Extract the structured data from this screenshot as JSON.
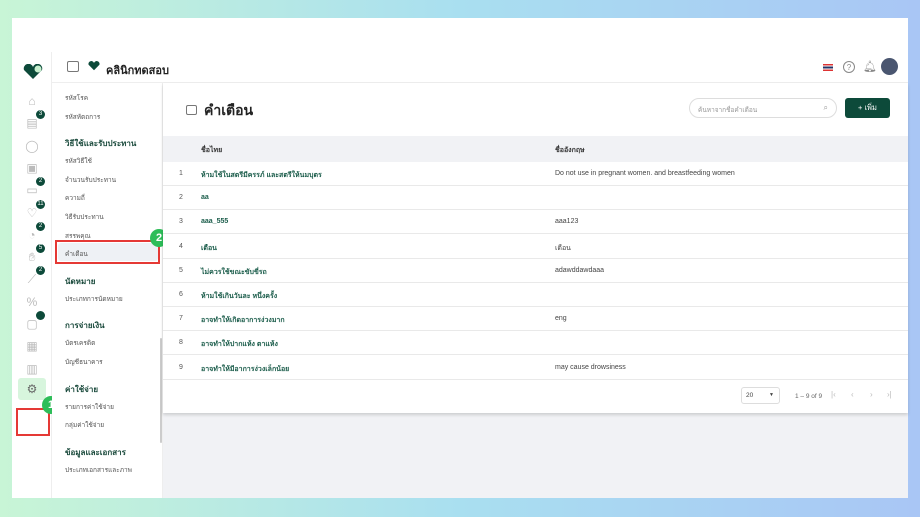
{
  "header": {
    "clinic_name": "คลินิกทดสอบ"
  },
  "rail": {
    "items": [
      {
        "icon": "home-icon",
        "badge": null
      },
      {
        "icon": "calendar-icon",
        "badge": "3"
      },
      {
        "icon": "user-icon",
        "badge": null
      },
      {
        "icon": "id-card-icon",
        "badge": null
      },
      {
        "icon": "bed-icon",
        "badge": "2"
      },
      {
        "icon": "stethoscope-icon",
        "badge": "11"
      },
      {
        "icon": "doctor-icon",
        "badge": "2"
      },
      {
        "icon": "hand-icon",
        "badge": "5"
      },
      {
        "icon": "pill-icon",
        "badge": "2"
      },
      {
        "icon": "percent-icon",
        "badge": null
      },
      {
        "icon": "box-icon",
        "badge": ""
      },
      {
        "icon": "grid-icon",
        "badge": null
      },
      {
        "icon": "chart-icon",
        "badge": null
      }
    ],
    "settings_icon": "gear-icon"
  },
  "annotations": {
    "step1": "1",
    "step2": "2"
  },
  "submenu": [
    {
      "type": "item",
      "label": "รหัสโรค"
    },
    {
      "type": "item",
      "label": "รหัสหัตถการ"
    },
    {
      "type": "heading",
      "label": "วิธีใช้และรับประทาน"
    },
    {
      "type": "item",
      "label": "รหัสวิธีใช้"
    },
    {
      "type": "item",
      "label": "จำนวนรับประทาน"
    },
    {
      "type": "item",
      "label": "ความถี่"
    },
    {
      "type": "item",
      "label": "วิธีรับประทาน"
    },
    {
      "type": "item",
      "label": "สรรพคุณ"
    },
    {
      "type": "item",
      "label": "คำเตือน",
      "selected": true
    },
    {
      "type": "heading",
      "label": "นัดหมาย"
    },
    {
      "type": "item",
      "label": "ประเภทการนัดหมาย"
    },
    {
      "type": "heading",
      "label": "การจ่ายเงิน"
    },
    {
      "type": "item",
      "label": "บัตรเครดิต"
    },
    {
      "type": "item",
      "label": "บัญชีธนาคาร"
    },
    {
      "type": "heading",
      "label": "ค่าใช้จ่าย"
    },
    {
      "type": "item",
      "label": "รายการค่าใช้จ่าย"
    },
    {
      "type": "item",
      "label": "กลุ่มค่าใช้จ่าย"
    },
    {
      "type": "heading",
      "label": "ข้อมูลและเอกสาร"
    },
    {
      "type": "item",
      "label": "ประเภทเอกสารและภาพ"
    }
  ],
  "page": {
    "title": "คำเตือน",
    "search_placeholder": "ค้นหาจากชื่อคำเตือน",
    "add_label": "+ เพิ่ม"
  },
  "table": {
    "headers": [
      "ชื่อไทย",
      "ชื่ออังกฤษ"
    ],
    "rows": [
      [
        "1",
        "ห้ามใช้ในสตรีมีครรภ์ และสตรีให้นมบุตร",
        "Do not use in pregnant women. and breastfeeding women"
      ],
      [
        "2",
        "aa",
        ""
      ],
      [
        "3",
        "aaa_555",
        "aaa123"
      ],
      [
        "4",
        "เตือน",
        "เตือน"
      ],
      [
        "5",
        "ไม่ควรใช้ขณะขับขี่รถ",
        "adawddawdaaa"
      ],
      [
        "6",
        "ห้ามใช้เกินวันละ หนึ่งครั้ง",
        ""
      ],
      [
        "7",
        "อาจทำให้เกิดอาการง่วงมาก",
        "eng"
      ],
      [
        "8",
        "อาจทำให้ปากแห้ง ตาแห้ง",
        ""
      ],
      [
        "9",
        "อาจทำให้มีอาการง่วงเล็กน้อย",
        "may cause drowsiness"
      ]
    ]
  },
  "pagination": {
    "page_size": "20",
    "range": "1 – 9 of 9"
  }
}
